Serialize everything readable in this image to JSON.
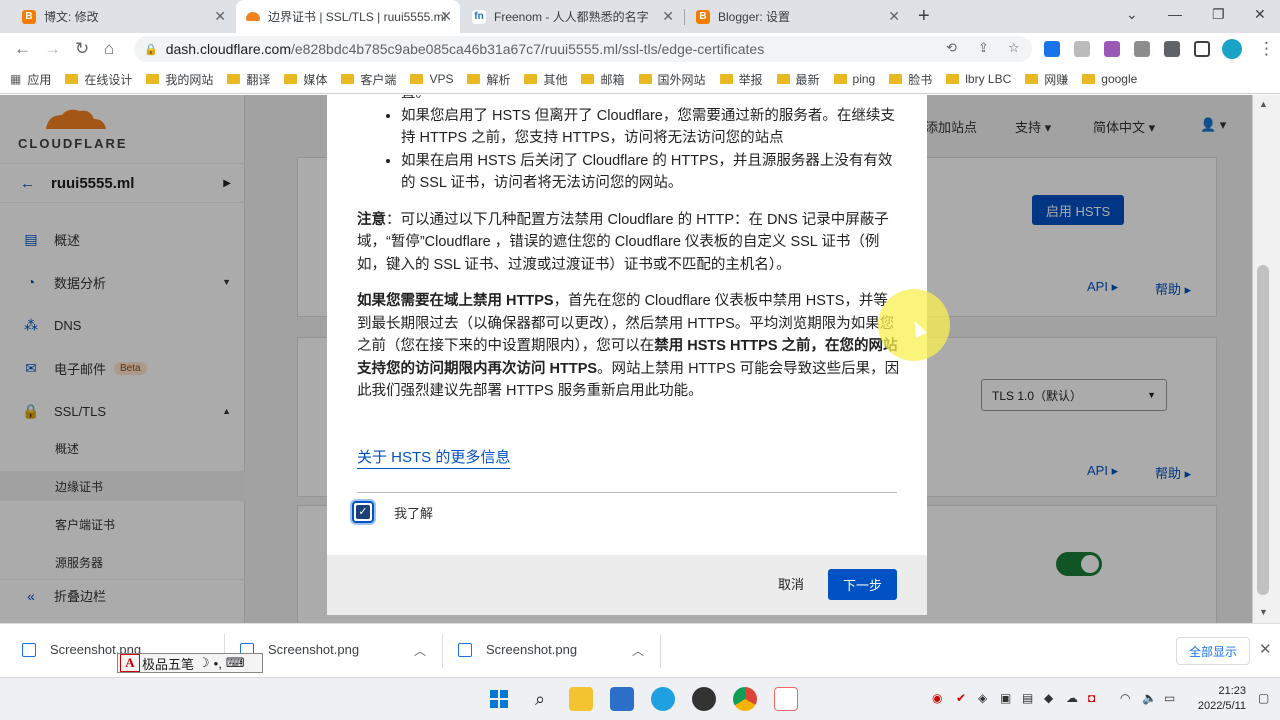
{
  "browser": {
    "tabs": [
      {
        "title": "博文: 修改",
        "favicon_color": "#f57c00",
        "active": false
      },
      {
        "title": "边界证书 | SSL/TLS | ruui5555.ml",
        "favicon_color": "#f48120",
        "active": true
      },
      {
        "title": "Freenom - 人人都熟悉的名字",
        "favicon_color": "#1e73be",
        "active": false
      },
      {
        "title": "Blogger: 设置",
        "favicon_color": "#f57c00",
        "active": false
      }
    ],
    "url_host": "dash.cloudflare.com",
    "url_path": "/e828bdc4b785c9abe085ca46b31a67c7/ruui5555.ml/ssl-tls/edge-certificates",
    "bookmarks": [
      "应用",
      "在线设计",
      "我的网站",
      "翻译",
      "媒体",
      "客户端",
      "VPS",
      "解析",
      "其他",
      "邮箱",
      "国外网站",
      "举报",
      "最新",
      "ping",
      "脸书",
      "lbry LBC",
      "网赚",
      "google"
    ]
  },
  "sidebar": {
    "site": "ruui5555.ml",
    "items": [
      {
        "label": "概述",
        "icon": "doc-icon"
      },
      {
        "label": "数据分析",
        "icon": "chart-icon"
      },
      {
        "label": "DNS",
        "icon": "network-icon"
      },
      {
        "label": "电子邮件",
        "icon": "mail-icon",
        "badge": "Beta"
      },
      {
        "label": "SSL/TLS",
        "icon": "lock-icon"
      }
    ],
    "sub_items": [
      "概述",
      "边缘证书",
      "客户端证书",
      "源服务器"
    ],
    "collapse": "折叠边栏"
  },
  "topnav": {
    "add_site": "添加站点",
    "support": "支持",
    "language": "简体中文"
  },
  "background": {
    "hsts_button": "启用 HSTS",
    "api": "API",
    "help": "帮助",
    "tls_select": "TLS 1.0（默认）"
  },
  "modal": {
    "bullet_fragment": "置。",
    "bullets": [
      "如果您启用了 HSTS 但离开了 Cloudflare，您需要通过新的服务者。在继续支持 HTTPS 之前，您支持 HTTPS，访问将无法访问您的站点",
      "如果在启用 HSTS 后关闭了 Cloudflare 的 HTTPS，并且源服务器上没有有效的 SSL 证书，访问者将无法访问您的网站。"
    ],
    "note_label": "注意",
    "note_text": "：可以通过以下几种配置方法禁用 Cloudflare 的 HTTP：在 DNS 记录中屏蔽子域，“暂停”Cloudflare ，错误的遮住您的 Cloudflare 仪表板的自定义 SSL 证书（例如，键入的 SSL 证书、过渡或过渡证书）证书或不匹配的主机名）。",
    "para_bold1": "如果您需要在域上禁用 HTTPS",
    "para_text1": "，首先在您的 Cloudflare 仪表板中禁用 HSTS，并等到最长期限过去（以确保器都可以更改），然后禁用 HTTPS。平均浏览期限为如果您之前（您在接下来的中设置期限内），您可以在",
    "para_bold2": "禁用 HSTS HTTPS 之前，在您的网站支持您的访问期限内再次访问 HTTPS",
    "para_text2": "。网站上禁用 HTTPS 可能会导致这些后果，因此我们强烈建议先部署 HTTPS 服务重新启用此功能。",
    "more_link": "关于 HSTS 的更多信息",
    "checkbox_label": "我了解",
    "checkbox_checked": true,
    "cancel": "取消",
    "next": "下一步"
  },
  "downloads": {
    "files": [
      "Screenshot.png",
      "Screenshot.png",
      "Screenshot.png"
    ],
    "show_all": "全部显示"
  },
  "ime": {
    "label": "极品五笔"
  },
  "taskbar": {
    "time": "21:23",
    "date": "2022/5/11"
  }
}
